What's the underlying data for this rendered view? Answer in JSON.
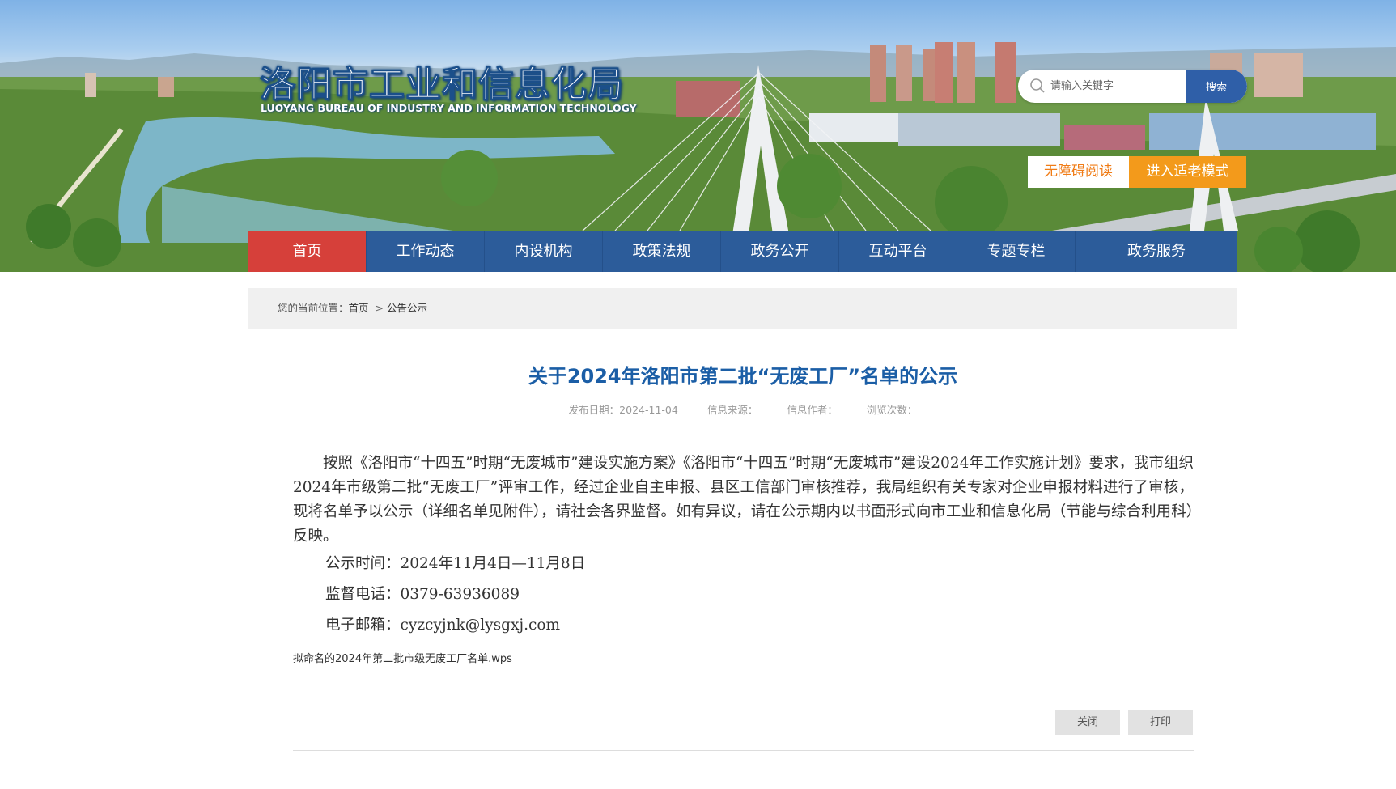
{
  "header": {
    "title": "洛阳市工业和信息化局",
    "subtitle": "LUOYANG BUREAU OF INDUSTRY AND INFORMATION TECHNOLOGY",
    "search": {
      "placeholder": "请输入关键字",
      "button_label": "搜索",
      "icon": "search-icon"
    },
    "accessibility_label": "无障碍阅读",
    "elderly_mode_label": "进入适老模式"
  },
  "nav": {
    "items": [
      {
        "label": "首页",
        "active": true
      },
      {
        "label": "工作动态"
      },
      {
        "label": "内设机构"
      },
      {
        "label": "政策法规"
      },
      {
        "label": "政务公开"
      },
      {
        "label": "互动平台"
      },
      {
        "label": "专题专栏"
      },
      {
        "label": "政务服务"
      }
    ]
  },
  "breadcrumb": {
    "prefix": "您的当前位置：",
    "home": "首页",
    "separator": ">",
    "current": "公告公示"
  },
  "article": {
    "title": "关于2024年洛阳市第二批“无废工厂”名单的公示",
    "meta": {
      "date": "发布日期：2024-11-04",
      "source": "信息来源：",
      "author": "信息作者：",
      "views": "浏览次数："
    },
    "paragraph": "按照《洛阳市“十四五”时期“无废城市”建设实施方案》《洛阳市“十四五”时期“无废城市”建设2024年工作实施计划》要求，我市组织2024年市级第二批“无废工厂”评审工作，经过企业自主申报、县区工信部门审核推荐，我局组织有关专家对企业申报材料进行了审核，现将名单予以公示（详细名单见附件），请社会各界监督。如有异议，请在公示期内以书面形式向市工业和信息化局（节能与综合利用科）反映。",
    "publicity_time": "公示时间：2024年11月4日—11月8日",
    "phone": "监督电话：0379-63936089",
    "email": "电子邮箱：cyzcyjnk@lysgxj.com",
    "attachment": "拟命名的2024年第二批市级无废工厂名单.wps"
  },
  "actions": {
    "close_label": "关闭",
    "print_label": "打印"
  },
  "colors": {
    "nav_bg": "#2c5c9a",
    "nav_active": "#d6403a",
    "title_blue": "#1b5ea6",
    "orange": "#f39a1b"
  }
}
